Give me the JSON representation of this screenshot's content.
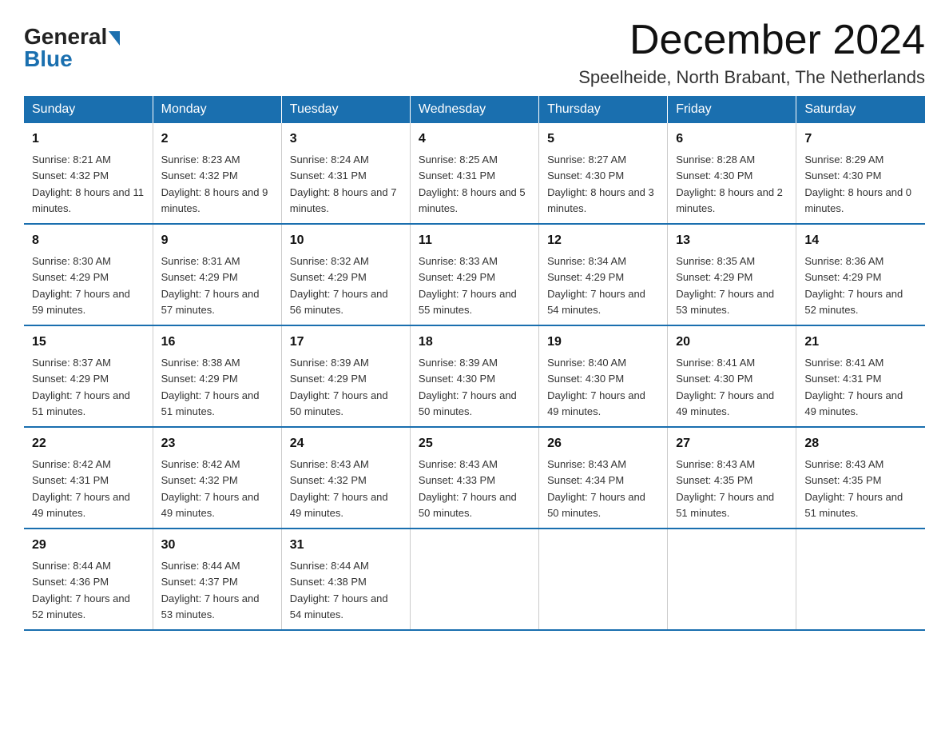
{
  "header": {
    "logo_general": "General",
    "logo_blue": "Blue",
    "month_title": "December 2024",
    "location": "Speelheide, North Brabant, The Netherlands"
  },
  "days_of_week": [
    "Sunday",
    "Monday",
    "Tuesday",
    "Wednesday",
    "Thursday",
    "Friday",
    "Saturday"
  ],
  "weeks": [
    [
      {
        "day": "1",
        "sunrise": "8:21 AM",
        "sunset": "4:32 PM",
        "daylight": "8 hours and 11 minutes."
      },
      {
        "day": "2",
        "sunrise": "8:23 AM",
        "sunset": "4:32 PM",
        "daylight": "8 hours and 9 minutes."
      },
      {
        "day": "3",
        "sunrise": "8:24 AM",
        "sunset": "4:31 PM",
        "daylight": "8 hours and 7 minutes."
      },
      {
        "day": "4",
        "sunrise": "8:25 AM",
        "sunset": "4:31 PM",
        "daylight": "8 hours and 5 minutes."
      },
      {
        "day": "5",
        "sunrise": "8:27 AM",
        "sunset": "4:30 PM",
        "daylight": "8 hours and 3 minutes."
      },
      {
        "day": "6",
        "sunrise": "8:28 AM",
        "sunset": "4:30 PM",
        "daylight": "8 hours and 2 minutes."
      },
      {
        "day": "7",
        "sunrise": "8:29 AM",
        "sunset": "4:30 PM",
        "daylight": "8 hours and 0 minutes."
      }
    ],
    [
      {
        "day": "8",
        "sunrise": "8:30 AM",
        "sunset": "4:29 PM",
        "daylight": "7 hours and 59 minutes."
      },
      {
        "day": "9",
        "sunrise": "8:31 AM",
        "sunset": "4:29 PM",
        "daylight": "7 hours and 57 minutes."
      },
      {
        "day": "10",
        "sunrise": "8:32 AM",
        "sunset": "4:29 PM",
        "daylight": "7 hours and 56 minutes."
      },
      {
        "day": "11",
        "sunrise": "8:33 AM",
        "sunset": "4:29 PM",
        "daylight": "7 hours and 55 minutes."
      },
      {
        "day": "12",
        "sunrise": "8:34 AM",
        "sunset": "4:29 PM",
        "daylight": "7 hours and 54 minutes."
      },
      {
        "day": "13",
        "sunrise": "8:35 AM",
        "sunset": "4:29 PM",
        "daylight": "7 hours and 53 minutes."
      },
      {
        "day": "14",
        "sunrise": "8:36 AM",
        "sunset": "4:29 PM",
        "daylight": "7 hours and 52 minutes."
      }
    ],
    [
      {
        "day": "15",
        "sunrise": "8:37 AM",
        "sunset": "4:29 PM",
        "daylight": "7 hours and 51 minutes."
      },
      {
        "day": "16",
        "sunrise": "8:38 AM",
        "sunset": "4:29 PM",
        "daylight": "7 hours and 51 minutes."
      },
      {
        "day": "17",
        "sunrise": "8:39 AM",
        "sunset": "4:29 PM",
        "daylight": "7 hours and 50 minutes."
      },
      {
        "day": "18",
        "sunrise": "8:39 AM",
        "sunset": "4:30 PM",
        "daylight": "7 hours and 50 minutes."
      },
      {
        "day": "19",
        "sunrise": "8:40 AM",
        "sunset": "4:30 PM",
        "daylight": "7 hours and 49 minutes."
      },
      {
        "day": "20",
        "sunrise": "8:41 AM",
        "sunset": "4:30 PM",
        "daylight": "7 hours and 49 minutes."
      },
      {
        "day": "21",
        "sunrise": "8:41 AM",
        "sunset": "4:31 PM",
        "daylight": "7 hours and 49 minutes."
      }
    ],
    [
      {
        "day": "22",
        "sunrise": "8:42 AM",
        "sunset": "4:31 PM",
        "daylight": "7 hours and 49 minutes."
      },
      {
        "day": "23",
        "sunrise": "8:42 AM",
        "sunset": "4:32 PM",
        "daylight": "7 hours and 49 minutes."
      },
      {
        "day": "24",
        "sunrise": "8:43 AM",
        "sunset": "4:32 PM",
        "daylight": "7 hours and 49 minutes."
      },
      {
        "day": "25",
        "sunrise": "8:43 AM",
        "sunset": "4:33 PM",
        "daylight": "7 hours and 50 minutes."
      },
      {
        "day": "26",
        "sunrise": "8:43 AM",
        "sunset": "4:34 PM",
        "daylight": "7 hours and 50 minutes."
      },
      {
        "day": "27",
        "sunrise": "8:43 AM",
        "sunset": "4:35 PM",
        "daylight": "7 hours and 51 minutes."
      },
      {
        "day": "28",
        "sunrise": "8:43 AM",
        "sunset": "4:35 PM",
        "daylight": "7 hours and 51 minutes."
      }
    ],
    [
      {
        "day": "29",
        "sunrise": "8:44 AM",
        "sunset": "4:36 PM",
        "daylight": "7 hours and 52 minutes."
      },
      {
        "day": "30",
        "sunrise": "8:44 AM",
        "sunset": "4:37 PM",
        "daylight": "7 hours and 53 minutes."
      },
      {
        "day": "31",
        "sunrise": "8:44 AM",
        "sunset": "4:38 PM",
        "daylight": "7 hours and 54 minutes."
      },
      null,
      null,
      null,
      null
    ]
  ],
  "labels": {
    "sunrise": "Sunrise:",
    "sunset": "Sunset:",
    "daylight": "Daylight:"
  }
}
